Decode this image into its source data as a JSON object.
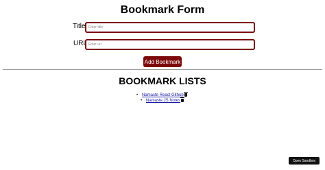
{
  "form": {
    "title": "Bookmark Form",
    "title_label": "Title:",
    "title_placeholder": "Enter title",
    "url_label": "URL:",
    "url_placeholder": "Enter url",
    "submit_label": "Add Bookmark"
  },
  "lists": {
    "title": "BOOKMARK LISTS",
    "items": [
      {
        "label": "Namaste React Github",
        "icon": "trash-icon"
      },
      {
        "label": "Namaste JS Notes",
        "icon": "trash-icon"
      }
    ]
  },
  "footer": {
    "sandbox_label": "Open Sandbox"
  },
  "colors": {
    "accent": "#7d0a0a",
    "input_border": "#7a0a12",
    "link": "#1a1aa6"
  }
}
